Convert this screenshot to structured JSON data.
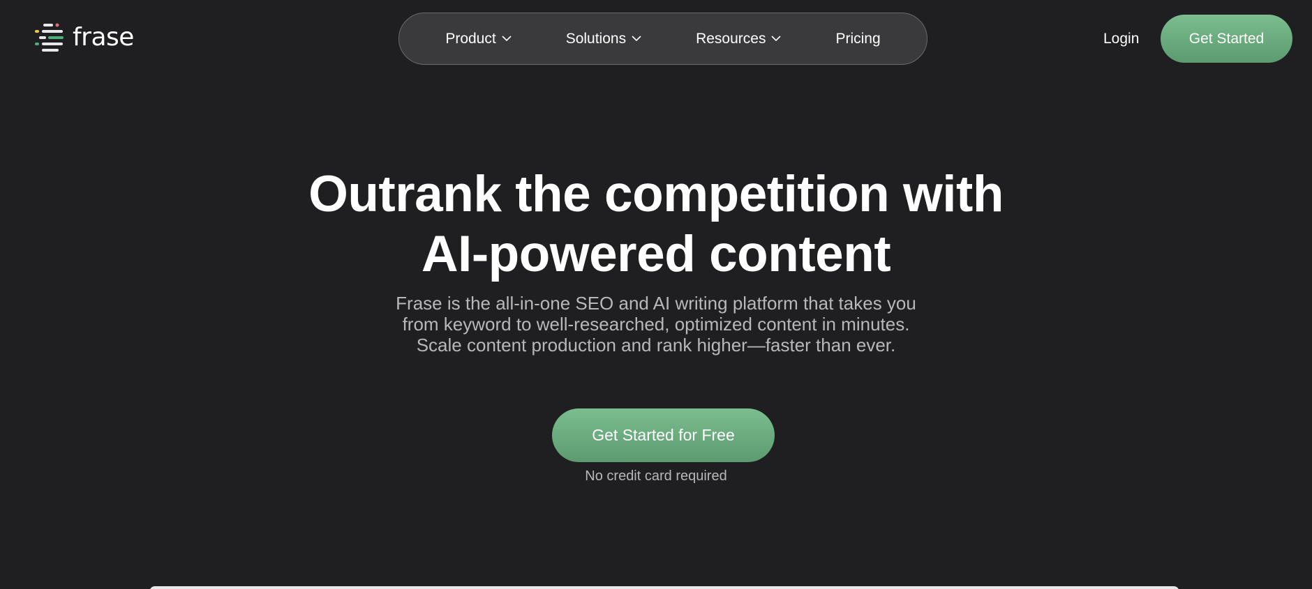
{
  "brand": {
    "name": "frase",
    "logo_colors": [
      "#f2c14e",
      "#4caf7d",
      "#e8e8ea",
      "#e06c75"
    ]
  },
  "nav": {
    "items": [
      {
        "label": "Product",
        "has_dropdown": true
      },
      {
        "label": "Solutions",
        "has_dropdown": true
      },
      {
        "label": "Resources",
        "has_dropdown": true
      },
      {
        "label": "Pricing",
        "has_dropdown": false
      }
    ]
  },
  "header": {
    "login_label": "Login",
    "cta_label": "Get Started"
  },
  "hero": {
    "title_line1": "Outrank the competition with",
    "title_line2": "AI-powered content",
    "subtitle_line1": "Frase is the all-in-one SEO and AI writing platform that takes you",
    "subtitle_line2": "from keyword to well-researched, optimized content in minutes.",
    "subtitle_line3": "Scale content production and rank higher—faster than ever.",
    "cta_label": "Get Started for Free",
    "note": "No credit card required"
  },
  "colors": {
    "background": "#1f1f21",
    "accent": "#6aa97d",
    "muted_text": "#b8b8bb"
  }
}
